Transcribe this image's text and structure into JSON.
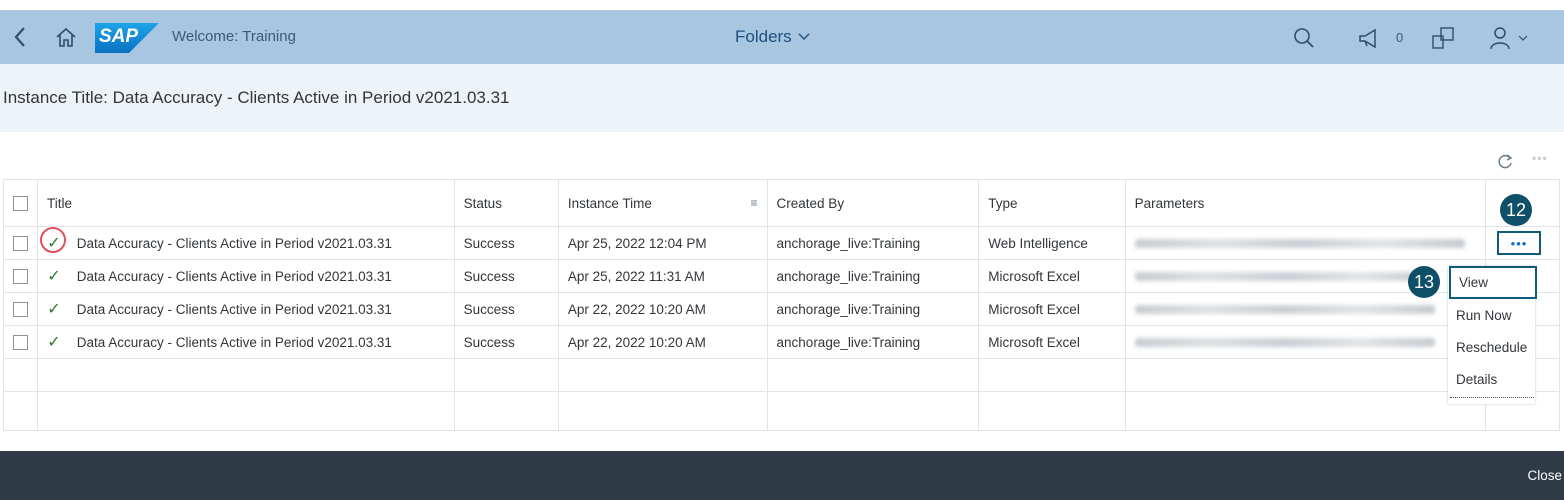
{
  "shell": {
    "welcome_text": "Welcome: Training",
    "folders_label": "Folders",
    "notification_count": "0",
    "logo_text": "SAP"
  },
  "header": {
    "instance_title": "Instance Title: Data Accuracy - Clients Active in Period v2021.03.31"
  },
  "table": {
    "columns": [
      "Title",
      "Status",
      "Instance Time",
      "Created By",
      "Type",
      "Parameters"
    ],
    "rows": [
      {
        "title": "Data Accuracy - Clients Active in Period v2021.03.31",
        "status": "Success",
        "time": "Apr 25, 2022 12:04 PM",
        "created_by": "anchorage_live:Training",
        "type": "Web Intelligence"
      },
      {
        "title": "Data Accuracy - Clients Active in Period v2021.03.31",
        "status": "Success",
        "time": "Apr 25, 2022 11:31 AM",
        "created_by": "anchorage_live:Training",
        "type": "Microsoft Excel"
      },
      {
        "title": "Data Accuracy - Clients Active in Period v2021.03.31",
        "status": "Success",
        "time": "Apr 22, 2022 10:20 AM",
        "created_by": "anchorage_live:Training",
        "type": "Microsoft Excel"
      },
      {
        "title": "Data Accuracy - Clients Active in Period v2021.03.31",
        "status": "Success",
        "time": "Apr 22, 2022 10:20 AM",
        "created_by": "anchorage_live:Training",
        "type": "Microsoft Excel"
      }
    ]
  },
  "callouts": {
    "step_12": "12",
    "step_13": "13"
  },
  "context_menu": {
    "items": [
      "View",
      "Run Now",
      "Reschedule",
      "Details"
    ]
  },
  "footer": {
    "close_label": "Close"
  },
  "colors": {
    "shellbar": "#a9c6e0",
    "footer": "#2f3b46",
    "success": "#2b7d2b",
    "callout": "#0f4f68"
  }
}
